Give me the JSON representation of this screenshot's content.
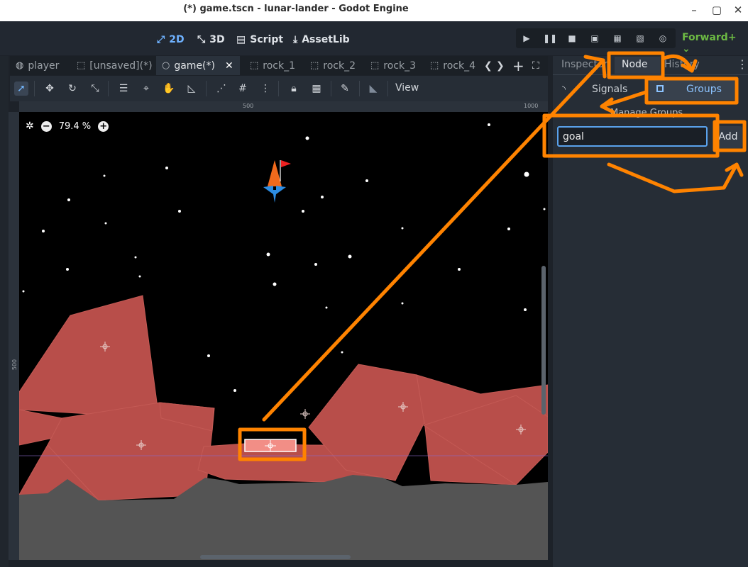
{
  "window": {
    "title": "(*) game.tscn - lunar-lander - Godot Engine",
    "minimize": "–",
    "maximize": "▢",
    "close": "✕"
  },
  "topbar": {
    "btn_2d": "2D",
    "btn_3d": "3D",
    "btn_script": "Script",
    "btn_assetlib": "AssetLib",
    "renderer": "Forward+"
  },
  "tabs": [
    {
      "label": "player"
    },
    {
      "label": "[unsaved](*)"
    },
    {
      "label": "game(*)"
    },
    {
      "label": "rock_1"
    },
    {
      "label": "rock_2"
    },
    {
      "label": "rock_3"
    },
    {
      "label": "rock_4"
    }
  ],
  "toolbar": {
    "view_label": "View"
  },
  "ruler": {
    "top_500": "500",
    "top_1000": "1000",
    "left_500": "500"
  },
  "viewport": {
    "zoom": "79.4 %"
  },
  "dock": {
    "tab_inspector": "Inspector",
    "tab_node": "Node",
    "tab_history": "History",
    "sub_signals": "Signals",
    "sub_groups": "Groups",
    "manage_groups": "Manage Groups",
    "group_input_value": "goal",
    "add_label": "Add"
  },
  "colors": {
    "accent": "#ff8300",
    "rock": "#b84e4a",
    "ground": "#545454",
    "goal": "#f28e86"
  }
}
